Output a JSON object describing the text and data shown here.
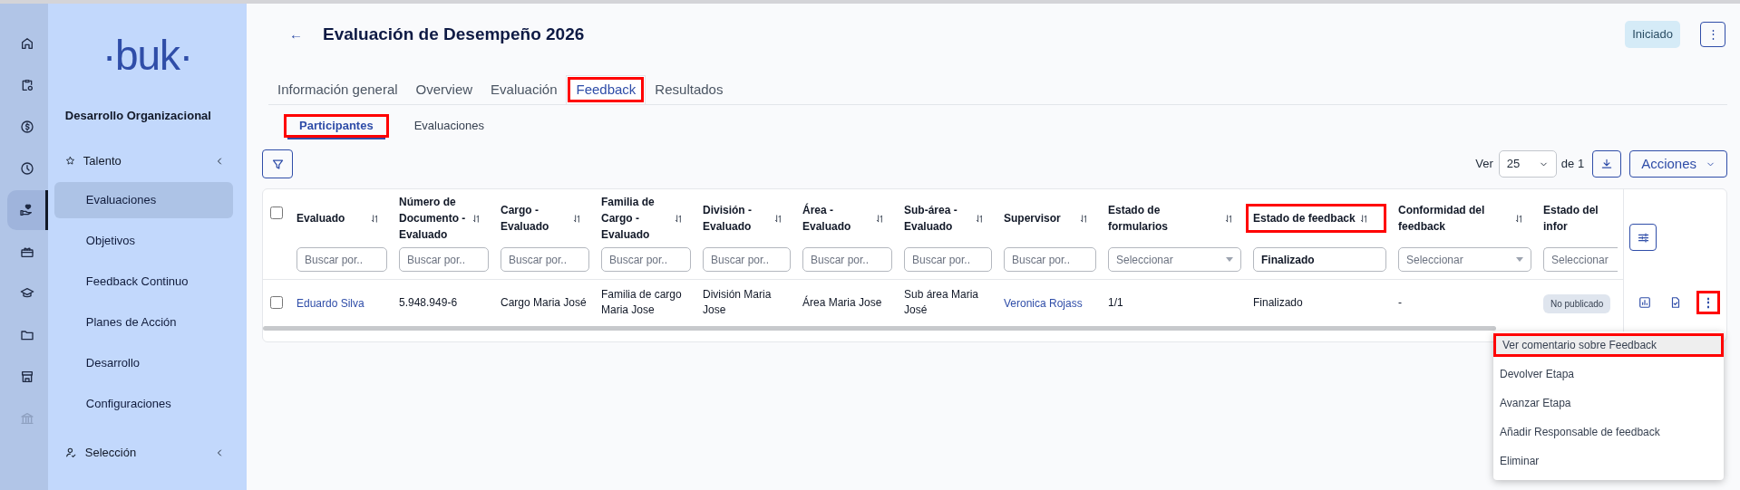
{
  "rail": [
    {
      "selected": false,
      "disabled": false
    },
    {
      "selected": false,
      "disabled": false
    },
    {
      "selected": false,
      "disabled": false
    },
    {
      "selected": false,
      "disabled": false
    },
    {
      "selected": true,
      "disabled": false
    },
    {
      "selected": false,
      "disabled": false
    },
    {
      "selected": false,
      "disabled": false
    },
    {
      "selected": false,
      "disabled": false
    },
    {
      "selected": false,
      "disabled": false
    },
    {
      "selected": false,
      "disabled": true
    }
  ],
  "sidebar": {
    "logo": "·buk·",
    "section": "Desarrollo Organizacional",
    "groups": [
      {
        "label": "Talento",
        "children": [
          {
            "label": "Evaluaciones",
            "selected": true
          },
          {
            "label": "Objetivos",
            "selected": false
          },
          {
            "label": "Feedback Continuo",
            "selected": false
          },
          {
            "label": "Planes de Acción",
            "selected": false
          },
          {
            "label": "Desarrollo",
            "selected": false
          },
          {
            "label": "Configuraciones",
            "selected": false
          }
        ]
      },
      {
        "label": "Selección"
      }
    ]
  },
  "header": {
    "back": "←",
    "title": "Evaluación de Desempeño 2026",
    "status": "Iniciado",
    "more": "⋮"
  },
  "tabs": [
    {
      "label": "Información general",
      "selected": false,
      "highlighted": false
    },
    {
      "label": "Overview",
      "selected": false,
      "highlighted": false
    },
    {
      "label": "Evaluación",
      "selected": false,
      "highlighted": false
    },
    {
      "label": "Feedback",
      "selected": true,
      "highlighted": true
    },
    {
      "label": "Resultados",
      "selected": false,
      "highlighted": false
    }
  ],
  "subtabs": [
    {
      "label": "Participantes",
      "selected": true,
      "highlighted": true
    },
    {
      "label": "Evaluaciones",
      "selected": false,
      "highlighted": false
    }
  ],
  "pager": {
    "show_label": "Ver",
    "page_size": "25",
    "of_label": "de 1",
    "actions": "Acciones"
  },
  "table": {
    "select_all_checked": false,
    "columns": [
      {
        "label": "Evaluado",
        "highlighted": false,
        "filter": {
          "kind": "text",
          "placeholder": "Buscar por.."
        }
      },
      {
        "label": "Número de Documento - Evaluado",
        "highlighted": false,
        "filter": {
          "kind": "text",
          "placeholder": "Buscar por.."
        }
      },
      {
        "label": "Cargo - Evaluado",
        "highlighted": false,
        "filter": {
          "kind": "text",
          "placeholder": "Buscar por.."
        }
      },
      {
        "label": "Familia de Cargo - Evaluado",
        "highlighted": false,
        "filter": {
          "kind": "text",
          "placeholder": "Buscar por.."
        }
      },
      {
        "label": "División - Evaluado",
        "highlighted": false,
        "filter": {
          "kind": "text",
          "placeholder": "Buscar por.."
        }
      },
      {
        "label": "Área - Evaluado",
        "highlighted": false,
        "filter": {
          "kind": "text",
          "placeholder": "Buscar por.."
        }
      },
      {
        "label": "Sub-área - Evaluado",
        "highlighted": false,
        "filter": {
          "kind": "text",
          "placeholder": "Buscar por.."
        }
      },
      {
        "label": "Supervisor",
        "highlighted": false,
        "filter": {
          "kind": "text",
          "placeholder": "Buscar por.."
        }
      },
      {
        "label": "Estado de formularios",
        "highlighted": false,
        "filter": {
          "kind": "select",
          "placeholder": "Seleccionar"
        }
      },
      {
        "label": "Estado de feedback",
        "highlighted": true,
        "filter": {
          "kind": "text",
          "value": "Finalizado"
        }
      },
      {
        "label": "Conformidad del feedback",
        "highlighted": false,
        "filter": {
          "kind": "select",
          "placeholder": "Seleccionar"
        }
      },
      {
        "label": "Estado del infor",
        "highlighted": false,
        "filter": {
          "kind": "cut",
          "placeholder": "Seleccionar"
        }
      }
    ],
    "rows": [
      {
        "checked": false,
        "more_highlighted": true,
        "cells": [
          {
            "kind": "link",
            "text": "Eduardo Silva"
          },
          {
            "kind": "text",
            "text": "5.948.949-6"
          },
          {
            "kind": "text",
            "text": "Cargo Maria José"
          },
          {
            "kind": "text",
            "text": "Familia de cargo Maria Jose"
          },
          {
            "kind": "text",
            "text": "División Maria Jose"
          },
          {
            "kind": "text",
            "text": "Área Maria Jose"
          },
          {
            "kind": "text",
            "text": "Sub área Maria José"
          },
          {
            "kind": "link",
            "text": "Veronica Rojass"
          },
          {
            "kind": "text",
            "text": "1/1"
          },
          {
            "kind": "text",
            "text": "Finalizado"
          },
          {
            "kind": "text",
            "text": "-"
          },
          {
            "kind": "badge",
            "text": "No publicado"
          }
        ]
      }
    ]
  },
  "menu": [
    {
      "label": "Ver comentario sobre Feedback",
      "selected": true,
      "highlighted": true
    },
    {
      "label": "Devolver Etapa",
      "selected": false,
      "highlighted": false
    },
    {
      "label": "Avanzar Etapa",
      "selected": false,
      "highlighted": false
    },
    {
      "label": "Añadir Responsable de feedback",
      "selected": false,
      "highlighted": false
    },
    {
      "label": "Eliminar",
      "selected": false,
      "highlighted": false
    }
  ]
}
